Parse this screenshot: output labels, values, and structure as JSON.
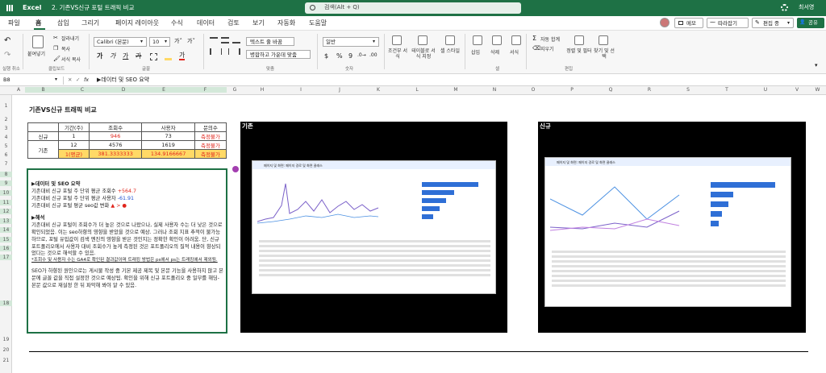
{
  "app": {
    "name": "Excel",
    "doc_title": "2. 기존VS신규 포털 트래픽 비교",
    "search_placeholder": "검색(Alt + Q)",
    "user": "최서영"
  },
  "menu": [
    "파일",
    "홈",
    "삽입",
    "그리기",
    "페이지 레이아웃",
    "수식",
    "데이터",
    "검토",
    "보기",
    "자동화",
    "도움말"
  ],
  "menu_active": 1,
  "top_buttons": {
    "memo": "메모",
    "follow": "따라잡기",
    "edit": "편집 중",
    "share": "공유"
  },
  "ribbon": {
    "undo_group": "실행 취소",
    "paste": "붙여넣기",
    "cut": "잘라내기",
    "copy": "복사",
    "format_painter": "서식 복사",
    "clipboard": "클립보드",
    "font_name": "Calibri (본문)",
    "font_size": "10",
    "font_group": "글꼴",
    "wrap_text": "텍스트 줄 바꿈",
    "merge_center": "병합하고 가운데 맞춤",
    "align_group": "맞춤",
    "number_format": "일반",
    "number_group": "숫자",
    "cond_format": "조건부 서식",
    "table_format": "테이블로 서식 지정",
    "cell_styles": "셀 스타일",
    "insert": "삽입",
    "delete": "삭제",
    "format": "서식",
    "cells_group": "셀",
    "autosum": "자동 합계",
    "fill": "지우기",
    "sort_filter": "정렬 및 필터",
    "find_select": "찾기 및 선택",
    "edit_group": "편집"
  },
  "formula_bar": {
    "cell_ref": "B8",
    "fx": "fx",
    "content": "▶데이터 및 SEO 요약"
  },
  "columns": [
    "A",
    "B",
    "C",
    "D",
    "E",
    "F",
    "G",
    "H",
    "I",
    "J",
    "K",
    "L",
    "M",
    "N",
    "O",
    "P",
    "Q",
    "R",
    "S",
    "T",
    "U",
    "V",
    "W"
  ],
  "rows": [
    "1",
    "2",
    "3",
    "4",
    "5",
    "6",
    "7",
    "8",
    "9",
    "10",
    "11",
    "12",
    "13",
    "14",
    "15",
    "16",
    "17",
    "18",
    "19",
    "20",
    "21"
  ],
  "sheet": {
    "title": "기존VS신규 트래픽 비교",
    "table_header": [
      "",
      "기간(주)",
      "조회수",
      "사용자",
      "문의수"
    ],
    "table_rows": [
      {
        "label": "신규",
        "cells": [
          "1",
          "946",
          "73",
          "측정불가"
        ]
      },
      {
        "label": "기존",
        "cells": [
          "12",
          "4576",
          "1619",
          "측정불가"
        ]
      },
      {
        "label": "",
        "cells": [
          "1(평균)",
          "381.3333333",
          "134.9166667",
          "측정불가"
        ]
      }
    ],
    "notes": {
      "h1": "▶데이터 및 SEO 요약",
      "l1": "기존대비 신규 포털 주 단위 평균 조회수",
      "l1v": "+564.7",
      "l2": "기존대비 신규 포털 주 단위 평균 사용자",
      "l2v": "-61.91",
      "l3": "기존대비 신규 포털 평균 seo값 변화",
      "l3v": "▲ > ●",
      "h2": "▶해석",
      "p1": "기존대비 신규 포털이 조회수가 더 높은 것으로 나왔으나, 실제 사용자 수는 더 낮은 것으로 확인되었음. 이는 seo하향의 영향을 받았을 것으로 예상. 그러나 조회 지표 추적이 불가능하므로, 포털 유입값이 검색 엔진의 영향을 받은 것인지는 정확한 확인이 어려움. 단, 신규포트폴리오에서 사용자 대비 조회수가 높게 측정된 것은 포트폴리오의 질적 내용이 향상되었다는 것으로 해석할 수 있음.",
      "p2": "*조회수 및 사용자 수는 GA4로 확인된 결과값이며 트래킹 방법은 ps에서 ps는 트래킹에서 제외됨.",
      "p3": "SEO가 하향된 원인으로는 게시물 작성 중 기본 제공 제목 및 본문 기능을 사용하지 않고 본문에 글꼴 값을 직접 설정한 것으로 예상됨. 확인을 위해 신규 포트폴리오 중 일부를 해딩-본문 값으로 재설정 한 뒤 파악해 봐야 알 수 있음."
    },
    "panel_old": "기존",
    "panel_new": "신규",
    "shot_tab": "페이지 및 화면: 페이지 경로 및 화면 클래스"
  },
  "colors": {
    "excel_green": "#1e7145",
    "highlight": "#ffd966",
    "red": "#e0251c"
  }
}
